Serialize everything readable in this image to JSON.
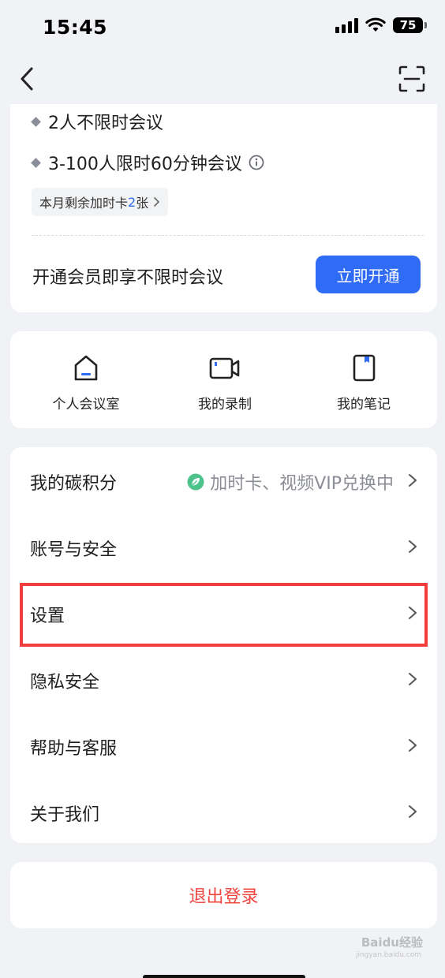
{
  "status_bar": {
    "time": "15:45",
    "battery": "75"
  },
  "plan": {
    "features": [
      "2人不限时会议",
      "3-100人限时60分钟会议"
    ],
    "extra_card_prefix": "本月剩余加时卡",
    "extra_card_count": "2",
    "extra_card_suffix": "张",
    "promo_text": "开通会员即享不限时会议",
    "open_button": "立即开通"
  },
  "shortcuts": [
    {
      "label": "个人会议室",
      "icon": "room-icon"
    },
    {
      "label": "我的录制",
      "icon": "video-record-icon"
    },
    {
      "label": "我的笔记",
      "icon": "notebook-icon"
    }
  ],
  "menu": [
    {
      "label": "我的碳积分",
      "extra": "加时卡、视频VIP兑换中"
    },
    {
      "label": "账号与安全"
    },
    {
      "label": "设置"
    },
    {
      "label": "隐私安全"
    },
    {
      "label": "帮助与客服"
    },
    {
      "label": "关于我们"
    }
  ],
  "logout": "退出登录",
  "watermark": {
    "text": "Baidu经验",
    "sub": "jingyan.baidu.com"
  },
  "colors": {
    "accent": "#2f6bf5",
    "danger": "#f0453f",
    "highlight": "#f23d3d",
    "leaf": "#4cc38a"
  }
}
